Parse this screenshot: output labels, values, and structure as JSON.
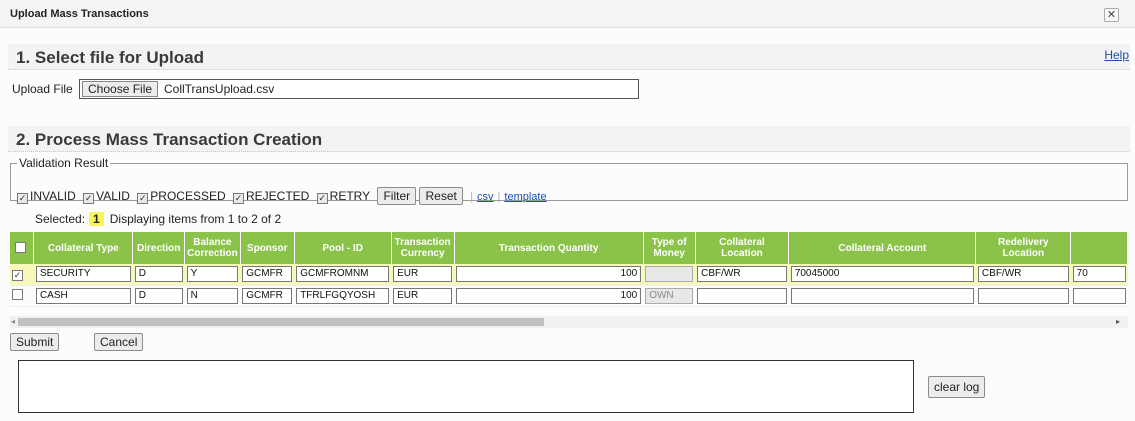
{
  "window": {
    "title": "Upload Mass Transactions",
    "close_glyph": "✕"
  },
  "section1": {
    "heading": "1. Select file for Upload",
    "help_link": "Help"
  },
  "upload": {
    "label": "Upload File",
    "choose_button": "Choose File",
    "file_name": "CollTransUpload.csv"
  },
  "section2": {
    "heading": "2. Process Mass Transaction Creation"
  },
  "validation": {
    "legend": "Validation Result",
    "filters": [
      {
        "label": "INVALID",
        "checked": true
      },
      {
        "label": "VALID",
        "checked": true
      },
      {
        "label": "PROCESSED",
        "checked": true
      },
      {
        "label": "REJECTED",
        "checked": true
      },
      {
        "label": "RETRY",
        "checked": true
      }
    ],
    "filter_button": "Filter",
    "reset_button": "Reset",
    "csv_link": "csv",
    "template_link": "template",
    "separator": "|"
  },
  "selection": {
    "selected_label": "Selected:",
    "selected_count": "1",
    "display_text": "Displaying items from 1 to 2 of 2"
  },
  "grid": {
    "header_color": "#8bc34a",
    "highlight_color": "#f7f9b8",
    "columns": [
      "Collateral Type",
      "Direction",
      "Balance Correction",
      "Sponsor",
      "Pool - ID",
      "Transaction Currency",
      "Transaction Quantity",
      "Type of Money",
      "Collateral Location",
      "Collateral Account",
      "Redelivery Location"
    ],
    "rows": [
      {
        "checked": true,
        "highlight": true,
        "values": [
          "SECURITY",
          "D",
          "Y",
          "GCMFR",
          "GCMFROMNM",
          "EUR",
          "100",
          "",
          "CBF/WR",
          "70045000",
          "CBF/WR",
          "70"
        ]
      },
      {
        "checked": false,
        "highlight": false,
        "values": [
          "CASH",
          "D",
          "N",
          "GCMFR",
          "TFRLFGQYOSH",
          "EUR",
          "100",
          "OWN",
          "",
          "",
          "",
          ""
        ]
      }
    ]
  },
  "scrollbar": {
    "left_arrow": "◂",
    "right_arrow": "▸"
  },
  "actions": {
    "submit": "Submit",
    "cancel": "Cancel",
    "clear_log": "clear log"
  }
}
